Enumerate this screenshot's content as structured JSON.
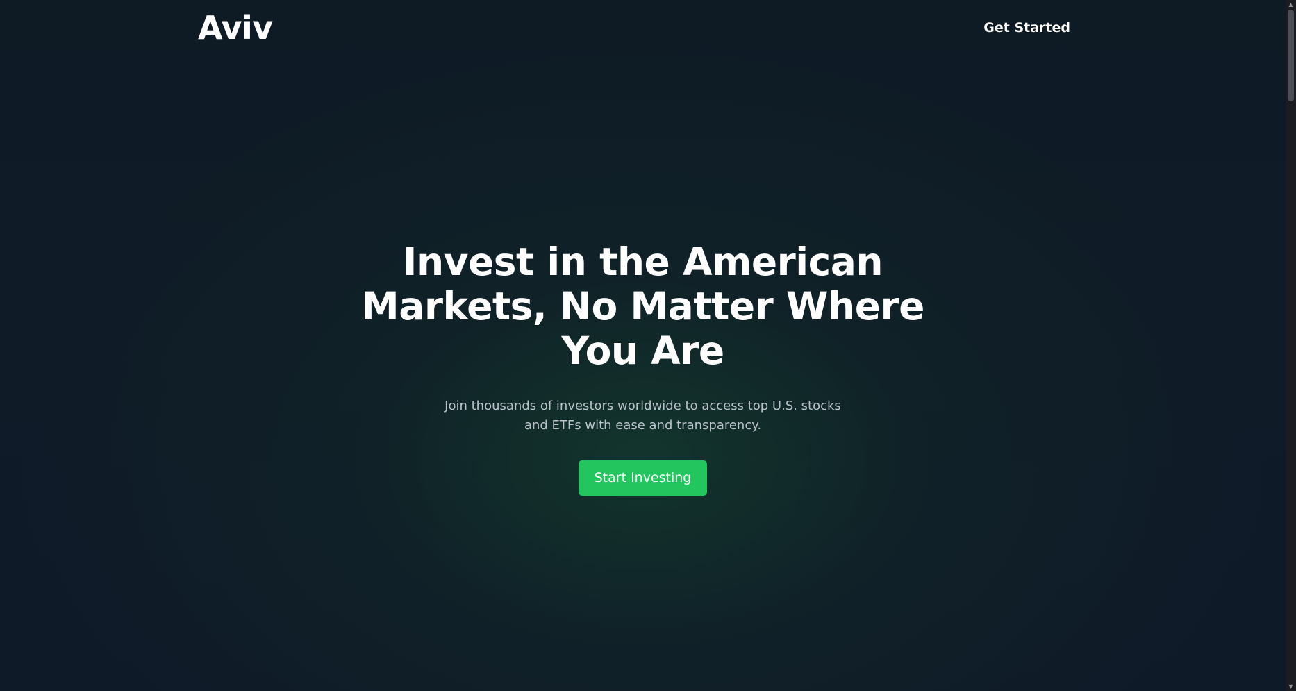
{
  "header": {
    "logo_text": "Aviv",
    "cta_label": "Get Started"
  },
  "hero": {
    "title": "Invest in the American Markets, No Matter Where You Are",
    "subtitle": "Join thousands of investors worldwide to access top U.S. stocks and ETFs with ease and transparency.",
    "button_label": "Start Investing"
  },
  "colors": {
    "accent": "#22c55e",
    "background": "#0f1b27",
    "text": "#ffffff",
    "subtext": "#b9c2ca"
  },
  "icons": {
    "scroll_up": "chevron-up-icon",
    "scroll_down": "chevron-down-icon"
  }
}
